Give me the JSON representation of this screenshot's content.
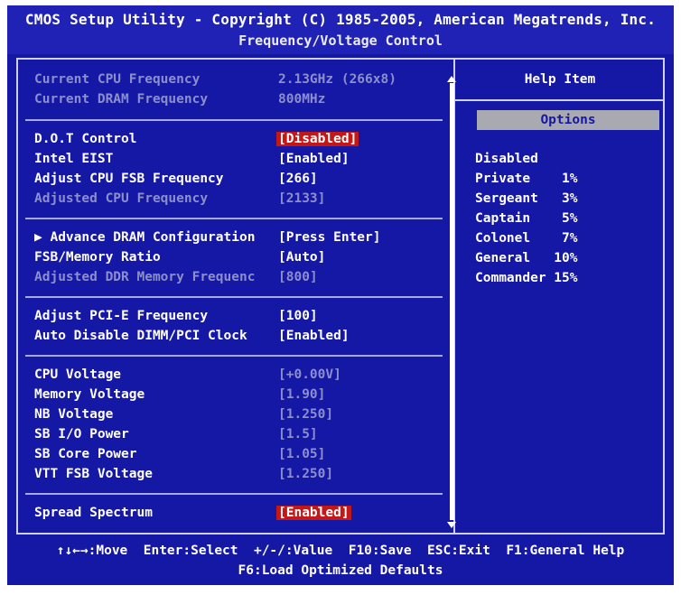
{
  "header": {
    "title": "CMOS Setup Utility - Copyright (C) 1985-2005, American Megatrends, Inc.",
    "subtitle": "Frequency/Voltage Control"
  },
  "info": [
    {
      "label": "Current CPU Frequency",
      "value": "2.13GHz (266x8)"
    },
    {
      "label": "Current DRAM Frequency",
      "value": "800MHz"
    }
  ],
  "group1": [
    {
      "label": "D.O.T Control",
      "value": "[Disabled]",
      "highlight": true
    },
    {
      "label": "Intel EIST",
      "value": "[Enabled]"
    },
    {
      "label": "Adjust CPU FSB Frequency",
      "value": "[266]"
    },
    {
      "label": "Adjusted CPU Frequency",
      "value": "[2133]",
      "dim": true
    }
  ],
  "group2": [
    {
      "label": "▶ Advance DRAM Configuration",
      "value": "[Press Enter]"
    },
    {
      "label": "FSB/Memory Ratio",
      "value": "[Auto]"
    },
    {
      "label": "Adjusted DDR Memory Frequenc",
      "value": "[800]",
      "dim": true
    }
  ],
  "group3": [
    {
      "label": "Adjust PCI-E Frequency",
      "value": "[100]"
    },
    {
      "label": "Auto Disable DIMM/PCI Clock",
      "value": "[Enabled]"
    }
  ],
  "group4": [
    {
      "label": "CPU Voltage",
      "value": "[+0.00V]"
    },
    {
      "label": "Memory Voltage",
      "value": "[1.90]"
    },
    {
      "label": "NB Voltage",
      "value": "[1.250]"
    },
    {
      "label": "SB I/O Power",
      "value": "[1.5]"
    },
    {
      "label": "SB Core Power",
      "value": "[1.05]"
    },
    {
      "label": "VTT FSB Voltage",
      "value": "[1.250]"
    }
  ],
  "group5": [
    {
      "label": "Spread Spectrum",
      "value": "[Enabled]",
      "highlight": true
    }
  ],
  "help": {
    "title": "Help Item",
    "options_label": "Options",
    "options": [
      "Disabled",
      "Private    1%",
      "Sergeant   3%",
      "Captain    5%",
      "Colonel    7%",
      "General   10%",
      "Commander 15%"
    ]
  },
  "footer": {
    "keys_line1": "↑↓←→:Move  Enter:Select  +/-/:Value  F10:Save  ESC:Exit  F1:General Help",
    "keys_line2": "F6:Load Optimized Defaults"
  },
  "colors": {
    "background": "#1518a4",
    "highlight": "#c41818",
    "dim_text": "#8d8fcc",
    "text": "#ffffff"
  }
}
